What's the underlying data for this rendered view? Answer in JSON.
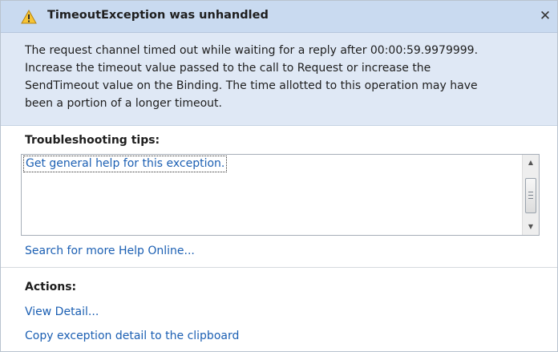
{
  "window": {
    "title": "TimeoutException was unhandled",
    "close_glyph": "✕"
  },
  "message": "The request channel timed out while waiting for a reply after 00:00:59.9979999.\nIncrease the timeout value passed to the call to Request or increase the\nSendTimeout value on the Binding. The time allotted to this operation may have\nbeen a portion of a longer timeout.",
  "troubleshooting": {
    "heading": "Troubleshooting tips:",
    "tips": [
      "Get general help for this exception."
    ]
  },
  "search_help_link": "Search for more Help Online...",
  "actions": {
    "heading": "Actions:",
    "items": [
      "View Detail...",
      "Copy exception detail to the clipboard"
    ]
  },
  "icons": {
    "warning": "warning-triangle-icon",
    "scroll_up": "scroll-up-arrow-icon",
    "scroll_down": "scroll-down-arrow-icon"
  },
  "colors": {
    "title_bar": "#c9daf0",
    "message_bg": "#dfe8f5",
    "link": "#1b5fb3",
    "warning_fill": "#f6c436"
  }
}
